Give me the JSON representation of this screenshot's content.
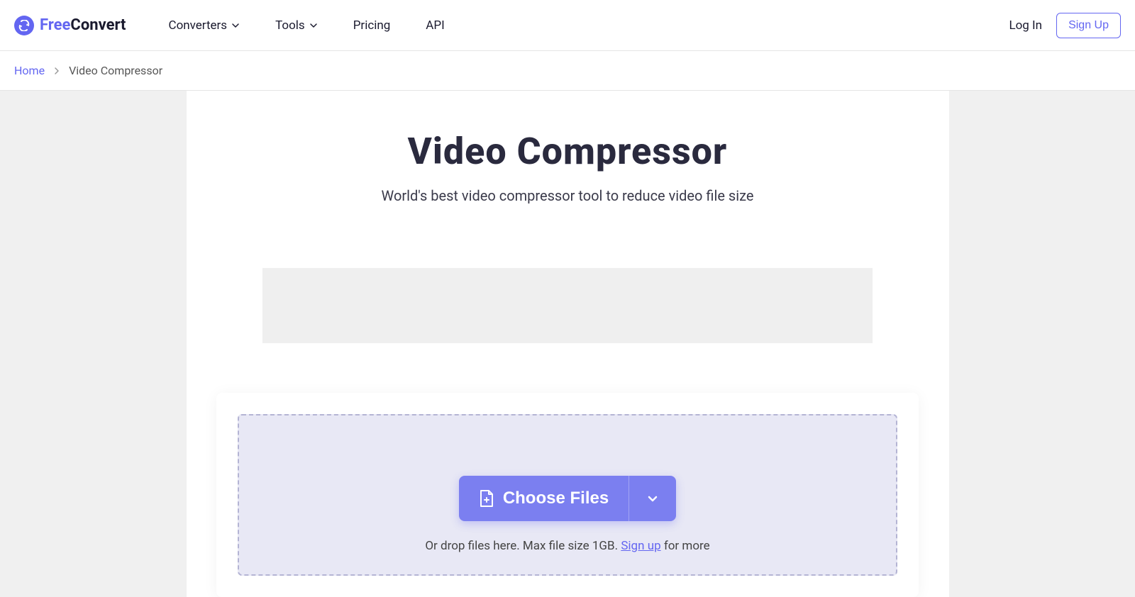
{
  "header": {
    "logo": {
      "free": "Free",
      "convert": "Convert"
    },
    "nav": {
      "converters": "Converters",
      "tools": "Tools",
      "pricing": "Pricing",
      "api": "API"
    },
    "login": "Log In",
    "signup": "Sign Up"
  },
  "breadcrumb": {
    "home": "Home",
    "current": "Video Compressor"
  },
  "main": {
    "title": "Video Compressor",
    "subtitle": "World's best video compressor tool to reduce video file size"
  },
  "upload": {
    "choose_files": "Choose Files",
    "hint_prefix": "Or drop files here. Max file size 1GB. ",
    "signup_link": "Sign up",
    "hint_suffix": " for more"
  }
}
